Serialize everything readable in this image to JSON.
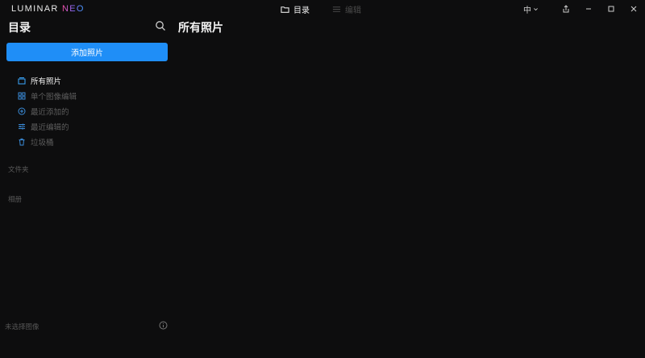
{
  "app": {
    "logo_main": "LUMINAR ",
    "logo_accent": "NEO"
  },
  "topnav": {
    "catalog": "目录",
    "edit": "编辑"
  },
  "window": {
    "language": "中"
  },
  "sidebar": {
    "title": "目录",
    "add_button": "添加照片",
    "items": [
      {
        "label": "所有照片",
        "icon": "photo-stack-icon"
      },
      {
        "label": "单个图像编辑",
        "icon": "grid-icon"
      },
      {
        "label": "最近添加的",
        "icon": "plus-circle-icon"
      },
      {
        "label": "最近编辑的",
        "icon": "sliders-icon"
      },
      {
        "label": "垃圾桶",
        "icon": "trash-icon"
      }
    ],
    "folders_label": "文件夹",
    "albums_label": "相册",
    "status": "未选择图像"
  },
  "main": {
    "title": "所有照片"
  },
  "colors": {
    "accent": "#1f8ef7",
    "background": "#0d0d0e"
  }
}
